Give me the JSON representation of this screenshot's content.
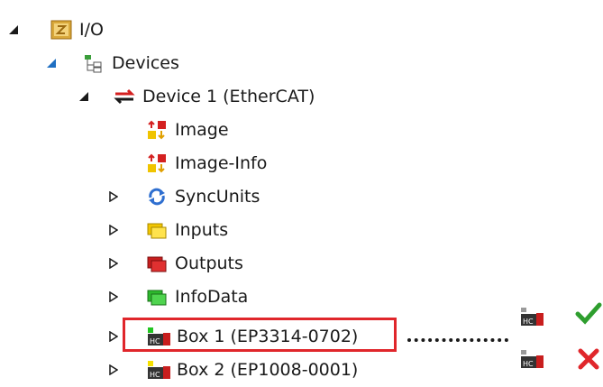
{
  "tree": {
    "root": {
      "label": "I/O",
      "icon": "io-folder-icon"
    },
    "devices": {
      "label": "Devices",
      "icon": "devices-icon"
    },
    "device1": {
      "label": "Device 1 (EtherCAT)",
      "icon": "ethercat-device-icon"
    },
    "children": [
      {
        "label": "Image",
        "icon": "image-icon",
        "expandable": false
      },
      {
        "label": "Image-Info",
        "icon": "image-info-icon",
        "expandable": false
      },
      {
        "label": "SyncUnits",
        "icon": "sync-units-icon",
        "expandable": true
      },
      {
        "label": "Inputs",
        "icon": "inputs-folder-icon",
        "expandable": true,
        "color": "#f2c600"
      },
      {
        "label": "Outputs",
        "icon": "outputs-folder-icon",
        "expandable": true,
        "color": "#c81e1e"
      },
      {
        "label": "InfoData",
        "icon": "infodata-folder-icon",
        "expandable": true,
        "color": "#2db82d"
      },
      {
        "label": "Box 1 (EP3314-0702)",
        "icon": "box-module-icon",
        "expandable": true,
        "status_led": "#22c522",
        "highlighted": true
      },
      {
        "label": "Box 2 (EP1008-0001)",
        "icon": "box-module-icon",
        "expandable": true,
        "status_led": "#f5e000"
      }
    ]
  },
  "legend": {
    "ok": {
      "icon": "box-module-icon",
      "status": "checkmark-icon",
      "color": "#2e9e2e"
    },
    "error": {
      "icon": "box-module-icon",
      "status": "cross-icon",
      "color": "#e0262b"
    }
  },
  "colors": {
    "highlight": "#e0262b",
    "text": "#1a1a1a"
  }
}
